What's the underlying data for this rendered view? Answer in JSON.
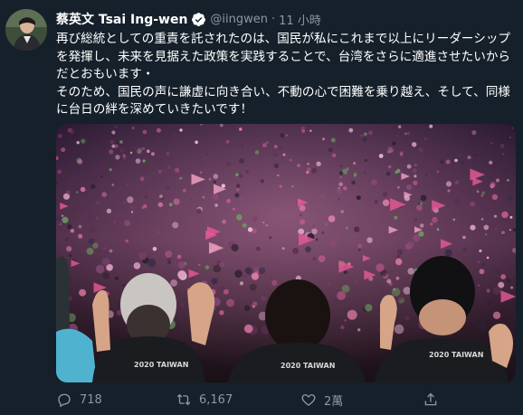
{
  "tweet": {
    "author_name": "蔡英文 Tsai Ing-wen",
    "handle": "@iingwen",
    "separator": "·",
    "time": "11 小時",
    "text": "再び総統としての重責を託されたのは、国民が私にこれまで以上にリーダーシップを発揮し、未来を見据えた政策を実践することで、台湾をさらに適進させたいからだとおもいます・\nそのため、国民の声に謙虚に向き合い、不動の心で困難を乗り越え、そして、同様に台日の絆を深めていきたいです！",
    "jersey_text": "2020 TAIWAN",
    "replies": "718",
    "retweets": "6,167",
    "likes": "2萬"
  },
  "icons": {
    "verified": "verified-badge-icon",
    "reply": "reply-icon",
    "retweet": "retweet-icon",
    "like": "heart-icon",
    "share": "share-icon"
  },
  "colors": {
    "background": "#15202b",
    "secondary_text": "#8899a6",
    "verified": "#1da1f2"
  }
}
